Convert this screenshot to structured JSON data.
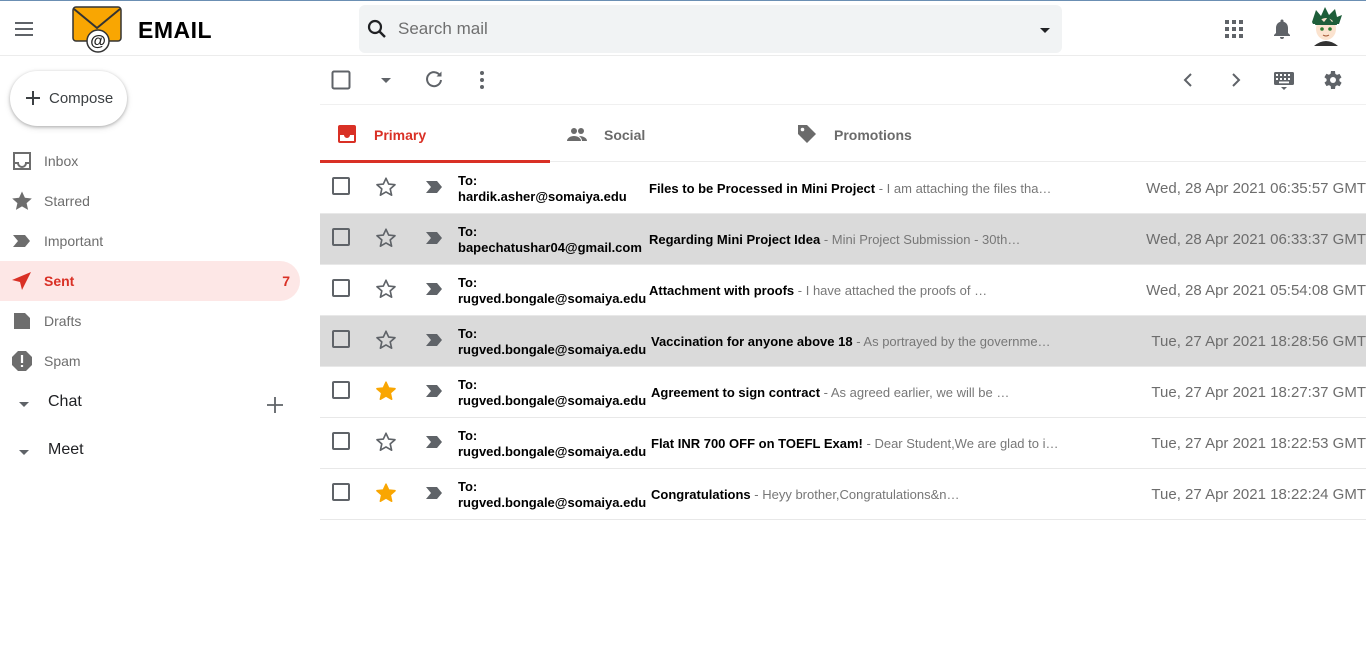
{
  "header": {
    "app_title": "EMAIL",
    "search_placeholder": "Search mail",
    "icons": [
      "menu-icon",
      "envelope-at-logo",
      "search-icon",
      "dropdown-arrow-icon",
      "apps-grid-icon",
      "bell-icon",
      "avatar"
    ]
  },
  "sidebar": {
    "compose_label": "Compose",
    "items": [
      {
        "label": "Inbox",
        "icon": "inbox-icon"
      },
      {
        "label": "Starred",
        "icon": "star-icon"
      },
      {
        "label": "Important",
        "icon": "important-icon"
      },
      {
        "label": "Sent",
        "icon": "send-icon",
        "count": "7",
        "active": true
      },
      {
        "label": "Drafts",
        "icon": "draft-icon"
      },
      {
        "label": "Spam",
        "icon": "spam-icon"
      }
    ],
    "sections": [
      {
        "label": "Chat"
      },
      {
        "label": "Meet"
      }
    ]
  },
  "tabs": [
    {
      "label": "Primary",
      "icon": "inbox-tab-icon",
      "active": true
    },
    {
      "label": "Social",
      "icon": "people-icon"
    },
    {
      "label": "Promotions",
      "icon": "tag-icon"
    }
  ],
  "colors": {
    "accent": "#d93025",
    "active_nav_bg": "#fde7e6",
    "starred": "#f9a602",
    "shaded_row": "#dadada"
  },
  "mails": [
    {
      "to_label": "To:",
      "to": "hardik.asher@somaiya.edu",
      "subject": "Files to be Processed in Mini Project",
      "snippet": " - I am attaching the files tha…",
      "date": "Wed, 28 Apr 2021 06:35:57 GMT",
      "starred": false,
      "shaded": false
    },
    {
      "to_label": "To:",
      "to": "bapechatushar04@gmail.com",
      "subject": "Regarding Mini Project Idea",
      "snippet": " - Mini Project Submission - 30th…",
      "date": "Wed, 28 Apr 2021 06:33:37 GMT",
      "starred": false,
      "shaded": true
    },
    {
      "to_label": "To:",
      "to": "rugved.bongale@somaiya.edu",
      "subject": "Attachment with proofs",
      "snippet": " - I have attached the proofs of …",
      "date": "Wed, 28 Apr 2021 05:54:08 GMT",
      "starred": false,
      "shaded": false
    },
    {
      "to_label": "To:",
      "to": "rugved.bongale@somaiya.edu",
      "subject": "Vaccination for anyone above 18",
      "snippet": " - As portrayed by the governme…",
      "date": "Tue, 27 Apr 2021 18:28:56 GMT",
      "starred": false,
      "shaded": true
    },
    {
      "to_label": "To:",
      "to": "rugved.bongale@somaiya.edu",
      "subject": "Agreement to sign contract",
      "snippet": " - As agreed earlier, we will be …",
      "date": "Tue, 27 Apr 2021 18:27:37 GMT",
      "starred": true,
      "shaded": false
    },
    {
      "to_label": "To:",
      "to": "rugved.bongale@somaiya.edu",
      "subject": "Flat INR 700 OFF on TOEFL Exam!",
      "snippet": " - Dear Student,We are glad to i…",
      "date": "Tue, 27 Apr 2021 18:22:53 GMT",
      "starred": false,
      "shaded": false
    },
    {
      "to_label": "To:",
      "to": "rugved.bongale@somaiya.edu",
      "subject": "Congratulations",
      "snippet": " - Heyy brother,Congratulations&n…",
      "date": "Tue, 27 Apr 2021 18:22:24 GMT",
      "starred": true,
      "shaded": false
    }
  ]
}
